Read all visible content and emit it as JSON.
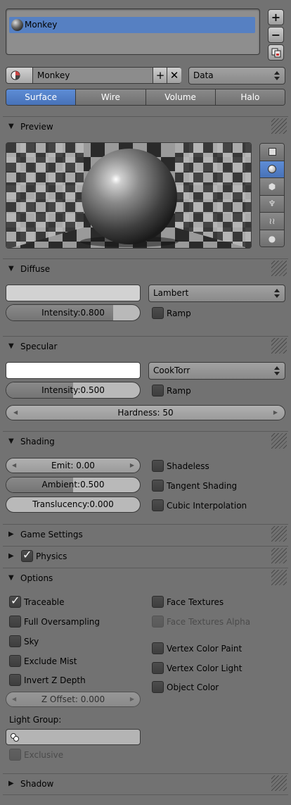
{
  "material_slots": [
    {
      "name": "Monkey",
      "selected": true
    }
  ],
  "slot_buttons": {
    "add": "+",
    "remove": "−"
  },
  "id_block": {
    "name": "Monkey",
    "link": "Data"
  },
  "tabs": [
    {
      "label": "Surface",
      "active": true
    },
    {
      "label": "Wire",
      "active": false
    },
    {
      "label": "Volume",
      "active": false
    },
    {
      "label": "Halo",
      "active": false
    }
  ],
  "panels": {
    "preview": "Preview",
    "diffuse": "Diffuse",
    "specular": "Specular",
    "shading": "Shading",
    "game_settings": "Game Settings",
    "physics": "Physics",
    "options": "Options",
    "shadow": "Shadow"
  },
  "preview_types": [
    "flat-icon",
    "sphere-icon",
    "cube-icon",
    "monkey-icon",
    "hair-icon",
    "sky-icon"
  ],
  "diffuse": {
    "color": "#d2d2d2",
    "shader": "Lambert",
    "intensity": "Intensity:0.800",
    "intensity_value": 0.8,
    "ramp": "Ramp"
  },
  "specular": {
    "color": "#ffffff",
    "shader": "CookTorr",
    "intensity": "Intensity:0.500",
    "intensity_value": 0.5,
    "ramp": "Ramp",
    "hardness": "Hardness: 50"
  },
  "shading": {
    "emit": "Emit: 0.00",
    "ambient": "Ambient:0.500",
    "ambient_value": 0.5,
    "translucency": "Translucency:0.000",
    "translucency_value": 0.0,
    "shadeless": "Shadeless",
    "tangent": "Tangent Shading",
    "cubic": "Cubic Interpolation"
  },
  "options": {
    "traceable": "Traceable",
    "full_oversampling": "Full Oversampling",
    "sky": "Sky",
    "exclude_mist": "Exclude Mist",
    "invert_z": "Invert Z Depth",
    "z_offset": "Z Offset: 0.000",
    "light_group_label": "Light Group:",
    "exclusive": "Exclusive",
    "face_textures": "Face Textures",
    "face_textures_alpha": "Face Textures Alpha",
    "vertex_color_paint": "Vertex Color Paint",
    "vertex_color_light": "Vertex Color Light",
    "object_color": "Object Color"
  }
}
